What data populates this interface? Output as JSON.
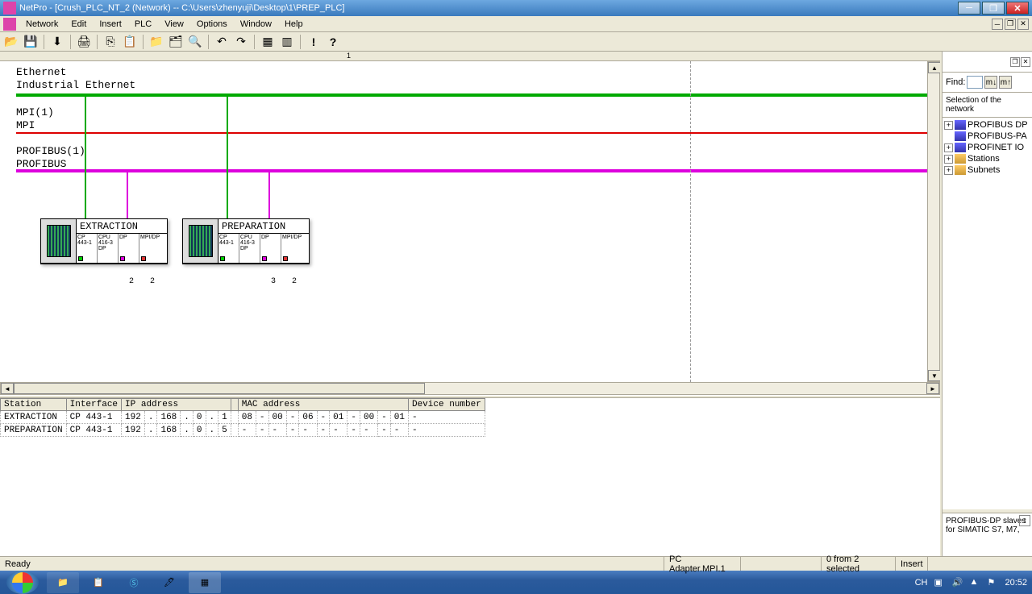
{
  "titlebar": {
    "text": "NetPro - [Crush_PLC_NT_2 (Network) -- C:\\Users\\zhenyuji\\Desktop\\1\\PREP_PLC]"
  },
  "menu": {
    "network": "Network",
    "edit": "Edit",
    "insert": "Insert",
    "plc": "PLC",
    "view": "View",
    "options": "Options",
    "window": "Window",
    "help": "Help"
  },
  "ruler": {
    "m1": "1"
  },
  "networks": {
    "eth_l1": "Ethernet",
    "eth_l2": "Industrial Ethernet",
    "mpi_l1": "MPI(1)",
    "mpi_l2": "MPI",
    "pb_l1": "PROFIBUS(1)",
    "pb_l2": "PROFIBUS"
  },
  "stations": {
    "s1": {
      "title": "EXTRACTION",
      "slot1": "CP 443-1",
      "slot2": "CPU 416-3 DP",
      "slot3": "DP",
      "slot4": "MPI/DP",
      "n1": "2",
      "n2": "2"
    },
    "s2": {
      "title": "PREPARATION",
      "slot1": "CP 443-1",
      "slot2": "CPU 416-3 DP",
      "slot3": "DP",
      "slot4": "MPI/DP",
      "n1": "3",
      "n2": "2"
    }
  },
  "table": {
    "headers": {
      "station": "Station",
      "interface": "Interface",
      "ip": "IP address",
      "mac": "MAC address",
      "devnum": "Device number"
    },
    "rows": [
      {
        "station": "EXTRACTION",
        "iface": "CP 443-1",
        "ip1": "192",
        "ip2": "168",
        "ip3": "0",
        "ip4": "1",
        "m1": "08",
        "m2": "00",
        "m3": "06",
        "m4": "01",
        "m5": "00",
        "m6": "01",
        "dev": "-"
      },
      {
        "station": "PREPARATION",
        "iface": "CP 443-1",
        "ip1": "192",
        "ip2": "168",
        "ip3": "0",
        "ip4": "5",
        "m1": "-",
        "m2": "-",
        "m3": "-",
        "m4": "-",
        "m5": "-",
        "m6": "-",
        "dev": "-"
      }
    ]
  },
  "right": {
    "find_label": "Find:",
    "sel_label": "Selection of the network",
    "tree": {
      "pb_dp": "PROFIBUS DP",
      "pb_pa": "PROFIBUS-PA",
      "pn_io": "PROFINET IO",
      "stations": "Stations",
      "subnets": "Subnets"
    },
    "desc": "PROFIBUS-DP slaves for SIMATIC S7, M7,"
  },
  "statusbar": {
    "ready": "Ready",
    "adapter": "PC Adapter.MPI.1",
    "selection": "0 from 2 selected",
    "mode": "Insert"
  },
  "tray": {
    "lang": "CH",
    "time": "20:52"
  }
}
